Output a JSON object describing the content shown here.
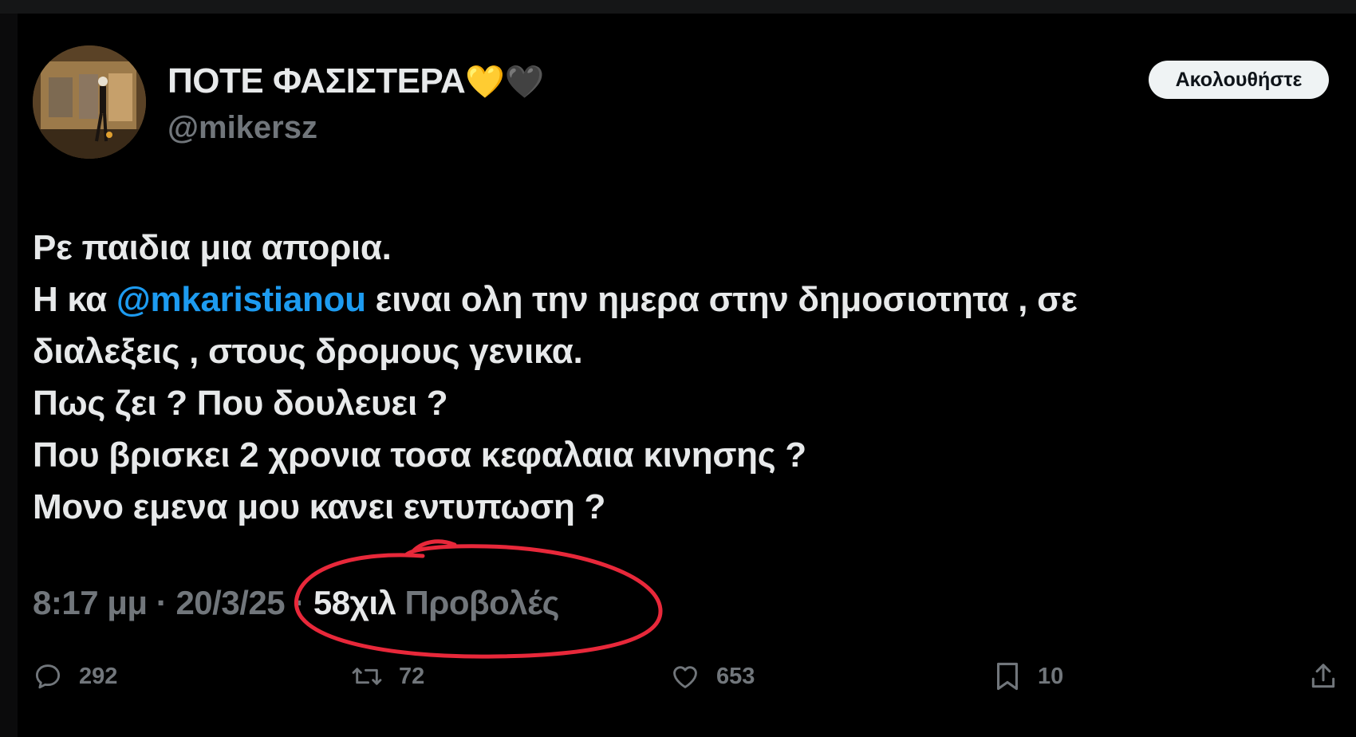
{
  "tweet": {
    "display_name": "ΠΟΤΕ ΦΑΣΙΣΤΕΡΑ",
    "name_emojis": "💛🖤",
    "handle": "@mikersz",
    "follow_label": "Ακολουθήστε",
    "text": {
      "line1": "Ρε παιδια μια απορια.",
      "line2_prefix": "Η κα ",
      "line2_mention": "@mkaristianou",
      "line2_suffix": " ειναι ολη την ημερα στην δημοσιοτητα , σε",
      "line3": "διαλεξεις , στους δρομους γενικα.",
      "line4": "Πως ζει ? Που δουλευει ?",
      "line5": "Που βρισκει 2 χρονια τοσα κεφαλαια κινησης ?",
      "line6": "Μονο εμενα μου κανει εντυπωση ?"
    },
    "time": "8:17 μμ",
    "separator": " · ",
    "date": "20/3/25",
    "views_count": "58χιλ",
    "views_label": "Προβολές"
  },
  "actions": {
    "replies": "292",
    "reposts": "72",
    "likes": "653",
    "bookmarks": "10"
  },
  "colors": {
    "background": "#000000",
    "text": "#e7e9ea",
    "secondary": "#71767b",
    "mention": "#1d9bf0",
    "annotation": "#e8283a",
    "follow_bg": "#eff3f4"
  }
}
